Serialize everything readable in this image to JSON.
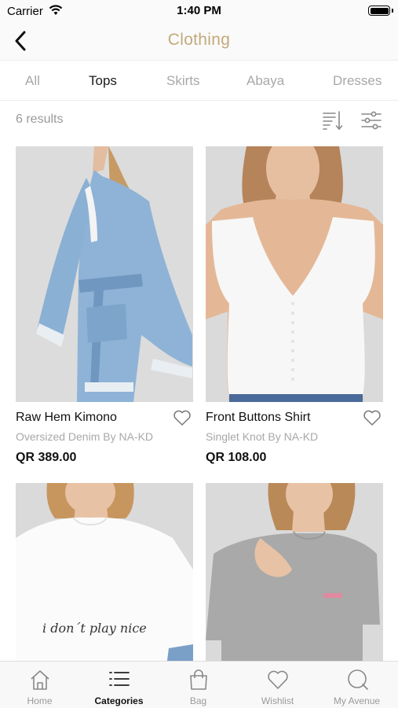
{
  "status_bar": {
    "carrier": "Carrier",
    "time": "1:40 PM"
  },
  "nav": {
    "title": "Clothing",
    "back_icon": "chevron-left-icon"
  },
  "tabs": [
    {
      "label": "All",
      "active": false
    },
    {
      "label": "Tops",
      "active": true
    },
    {
      "label": "Skirts",
      "active": false
    },
    {
      "label": "Abaya",
      "active": false
    },
    {
      "label": "Dresses",
      "active": false
    }
  ],
  "results": {
    "count_text": "6 results",
    "sort_icon": "sort-icon",
    "filter_icon": "filter-sliders-icon"
  },
  "products": [
    {
      "name": "Raw Hem Kimono",
      "brand": "Oversized Denim By NA-KD",
      "price": "QR 389.00"
    },
    {
      "name": "Front Buttons Shirt",
      "brand": "Singlet Knot By NA-KD",
      "price": "QR 108.00"
    },
    {
      "name": "",
      "brand": "",
      "price": "",
      "print_text": "i don´t play nice"
    },
    {
      "name": "",
      "brand": "",
      "price": ""
    }
  ],
  "tab_bar": [
    {
      "label": "Home",
      "icon": "home-icon",
      "active": false
    },
    {
      "label": "Categories",
      "icon": "list-icon",
      "active": true
    },
    {
      "label": "Bag",
      "icon": "bag-icon",
      "active": false
    },
    {
      "label": "Wishlist",
      "icon": "heart-icon",
      "active": false
    },
    {
      "label": "My Avenue",
      "icon": "search-circle-icon",
      "active": false
    }
  ],
  "colors": {
    "accent": "#c2a97a",
    "inactive": "#a8a8a8",
    "image_bg": "#d9d9d9"
  }
}
